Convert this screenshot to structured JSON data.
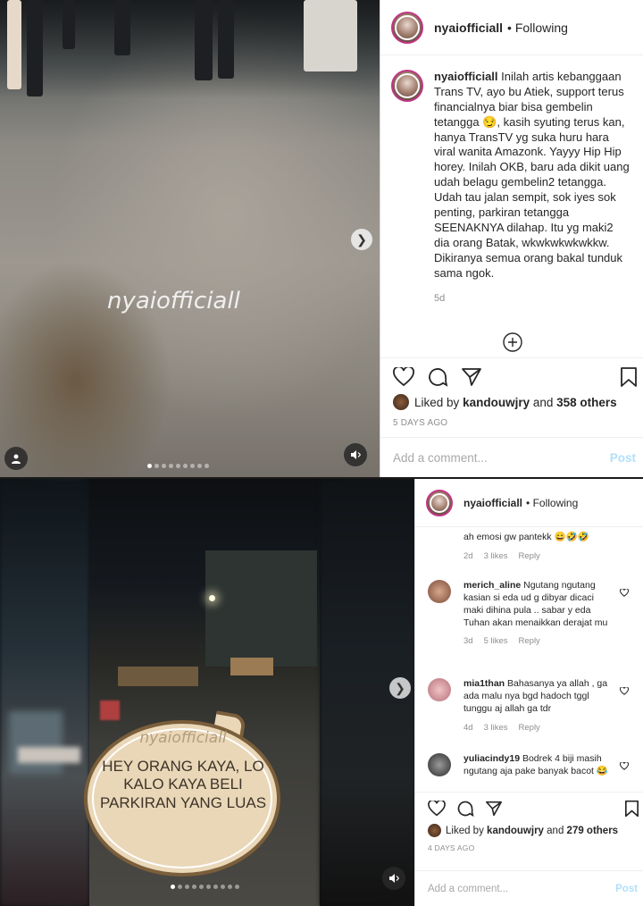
{
  "post1": {
    "watermark": "nyaiofficiall",
    "header": {
      "username": "nyaiofficiall",
      "follow_label": "• Following"
    },
    "caption": {
      "username": "nyaiofficiall",
      "text": "Inilah artis kebanggaan Trans TV, ayo bu Atiek, support terus financialnya biar bisa gembelin tetangga 😏, kasih syuting terus kan, hanya TransTV yg suka huru hara viral wanita Amazonk. Yayyy Hip Hip horey. Inilah OKB, baru ada dikit uang udah belagu gembelin2 tetangga. Udah tau jalan sempit, sok iyes sok penting, parkiran tetangga SEENAKNYA dilahap. Itu yg maki2 dia orang Batak, wkwkwkwkwkkw. Dikiranya semua orang bakal tunduk sama ngok.",
      "age": "5d"
    },
    "likes": {
      "prefix": "Liked by",
      "user": "kandouwjry",
      "joiner": "and",
      "others": "358 others"
    },
    "date": "5 DAYS AGO",
    "comment_placeholder": "Add a comment...",
    "post_label": "Post",
    "carousel": {
      "count": 9,
      "active_index": 0
    }
  },
  "post2": {
    "bubble_watermark": "nyaiofficiall",
    "bubble_text": "HEY ORANG KAYA, LO KALO KAYA BELI PARKIRAN YANG LUAS",
    "header": {
      "username": "nyaiofficiall",
      "follow_label": "• Following"
    },
    "comments": [
      {
        "text": "ah emosi gw pantekk 😄🤣🤣",
        "age": "2d",
        "likes": "3 likes",
        "reply": "Reply"
      },
      {
        "username": "merich_aline",
        "text": "Ngutang ngutang kasian si eda ud g dibyar dicaci maki dihina pula .. sabar y eda Tuhan akan menaikkan derajat mu",
        "age": "3d",
        "likes": "5 likes",
        "reply": "Reply"
      },
      {
        "username": "mia1than",
        "text": "Bahasanya ya allah , ga ada malu nya bgd hadoch tggl tunggu aj allah ga tdr",
        "age": "4d",
        "likes": "3 likes",
        "reply": "Reply"
      },
      {
        "username": "yuliacindy19",
        "text": "Bodrek 4 biji masih ngutang aja pake banyak bacot 😂"
      }
    ],
    "likes": {
      "prefix": "Liked by",
      "user": "kandouwjry",
      "joiner": "and",
      "others": "279 others"
    },
    "date": "4 DAYS AGO",
    "comment_placeholder": "Add a comment...",
    "post_label": "Post",
    "carousel": {
      "count": 10,
      "active_index": 0
    }
  },
  "colors": {
    "ig_link_disabled": "#b2dffc",
    "text_primary": "#262626",
    "text_secondary": "#8e8e8e",
    "story_ring": "#c13584"
  },
  "icons": [
    "heart-icon",
    "comment-icon",
    "share-icon",
    "bookmark-icon",
    "add-icon",
    "sound-icon",
    "user-tag-icon",
    "chevron-right-icon"
  ]
}
